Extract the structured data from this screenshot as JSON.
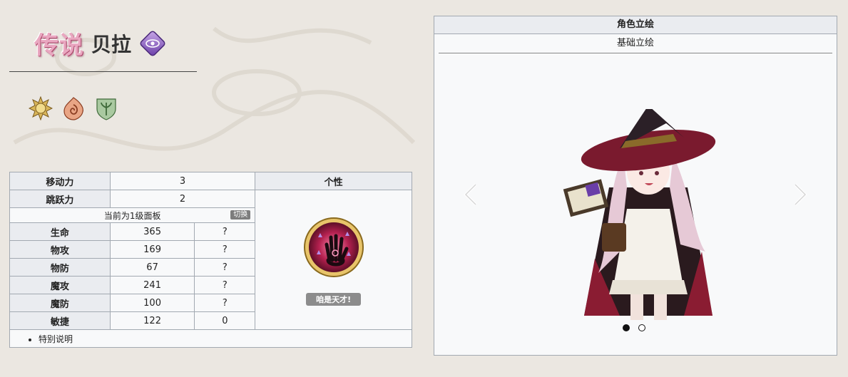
{
  "header": {
    "rarity_label": "传说",
    "character_name": "贝拉"
  },
  "stats_table": {
    "rows_top": [
      {
        "label": "移动力",
        "value": "3"
      },
      {
        "label": "跳跃力",
        "value": "2"
      }
    ],
    "trait_header": "个性",
    "panel_text": "当前为1级面板",
    "switch_label": "切换",
    "rows_stats": [
      {
        "label": "生命",
        "value": "365",
        "extra": "?"
      },
      {
        "label": "物攻",
        "value": "169",
        "extra": "?"
      },
      {
        "label": "物防",
        "value": "67",
        "extra": "?"
      },
      {
        "label": "魔攻",
        "value": "241",
        "extra": "?"
      },
      {
        "label": "魔防",
        "value": "100",
        "extra": "?"
      },
      {
        "label": "敏捷",
        "value": "122",
        "extra": "0"
      }
    ],
    "trait_name": "咱是天才!",
    "note": "特别说明"
  },
  "art_panel": {
    "header": "角色立绘",
    "tab": "基础立绘",
    "carousel": {
      "active_index": 0,
      "count": 2
    }
  },
  "colors": {
    "rarity_pink": "#e9a7c0",
    "table_header_bg": "#eaecf0",
    "table_border": "#a2a9b1",
    "cell_bg": "#f8f9fa"
  },
  "icons": {
    "class_badge": "purple-eye-diamond-icon",
    "affinities": [
      "sun-emblem-icon",
      "flame-swirl-icon",
      "leaf-crest-icon"
    ],
    "trait": "glowing-hand-icon"
  }
}
